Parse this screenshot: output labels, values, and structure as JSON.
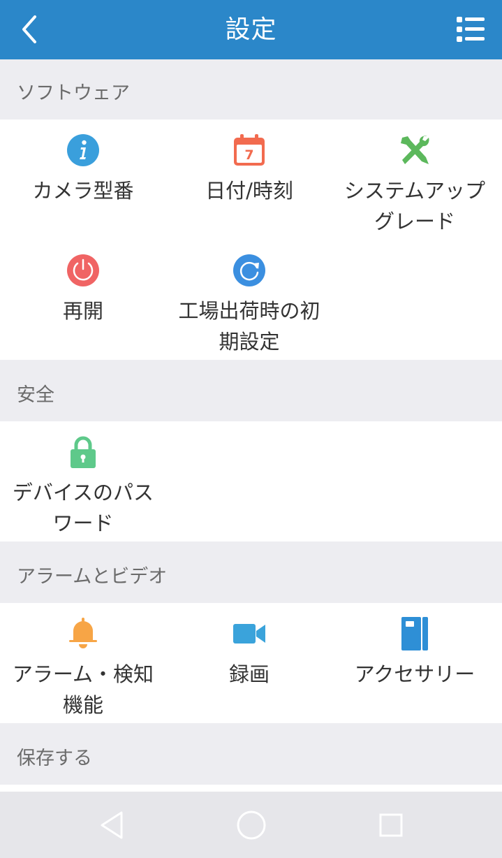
{
  "header": {
    "title": "設定"
  },
  "sections": [
    {
      "title": "ソフトウェア"
    },
    {
      "title": "安全"
    },
    {
      "title": "アラームとビデオ"
    },
    {
      "title": "保存する"
    }
  ],
  "software": {
    "camera_model": {
      "label1": "カメラ型番",
      "icon": "info-icon"
    },
    "datetime": {
      "label1": "日付/時刻",
      "icon": "calendar-icon",
      "calendar_day": "7"
    },
    "upgrade": {
      "label1": "システムアップ",
      "label2": "グレード",
      "icon": "tools-icon"
    },
    "restart": {
      "label1": "再開",
      "icon": "power-icon"
    },
    "factory_reset": {
      "label1": "工場出荷時の初",
      "label2": "期設定",
      "icon": "refresh-icon"
    }
  },
  "security": {
    "device_password": {
      "label1": "デバイスのパス",
      "label2": "ワード",
      "icon": "lock-icon"
    }
  },
  "alarm_video": {
    "alarm_detection": {
      "label1": "アラーム・検知",
      "label2": "機能",
      "icon": "bell-icon"
    },
    "recording": {
      "label1": "録画",
      "icon": "video-camera-icon"
    },
    "accessories": {
      "label1": "アクセサリー",
      "icon": "book-icon"
    }
  },
  "colors": {
    "header": "#2b87c9",
    "info": "#3a9fdc",
    "calendar": "#f26b4f",
    "tools": "#5cb85c",
    "power": "#f06464",
    "refresh": "#3b8fe0",
    "lock": "#5ec98a",
    "bell": "#f7a546",
    "video": "#3aa3db",
    "book": "#2e8fd6"
  }
}
